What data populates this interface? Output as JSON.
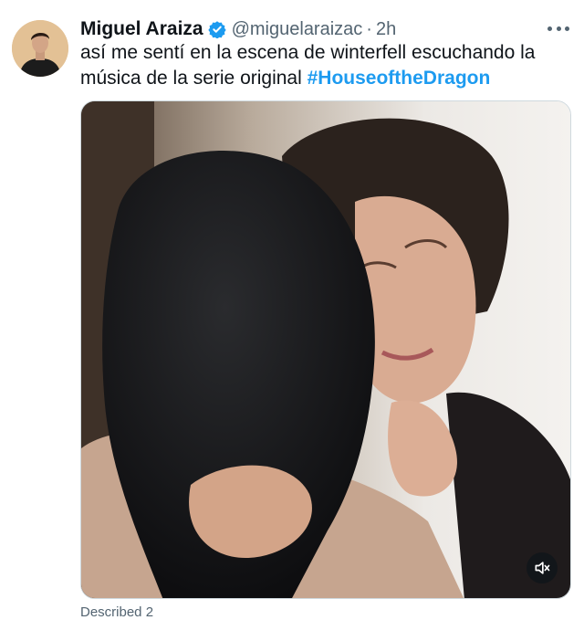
{
  "tweet": {
    "author_name": "Miguel Araiza",
    "handle": "@miguelaraizac",
    "separator": "·",
    "time": "2h",
    "text_before": "así me sentí en la escena de winterfell escuchando la música de la serie original ",
    "hashtag": "#HouseoftheDragon",
    "footer_partial": "Described 2"
  },
  "icons": {
    "verified": "verified-badge-icon",
    "more": "more-options-icon",
    "mute": "volume-muted-icon"
  },
  "colors": {
    "link": "#1d9bf0",
    "secondary_text": "#536471",
    "verified": "#1d9bf0"
  }
}
